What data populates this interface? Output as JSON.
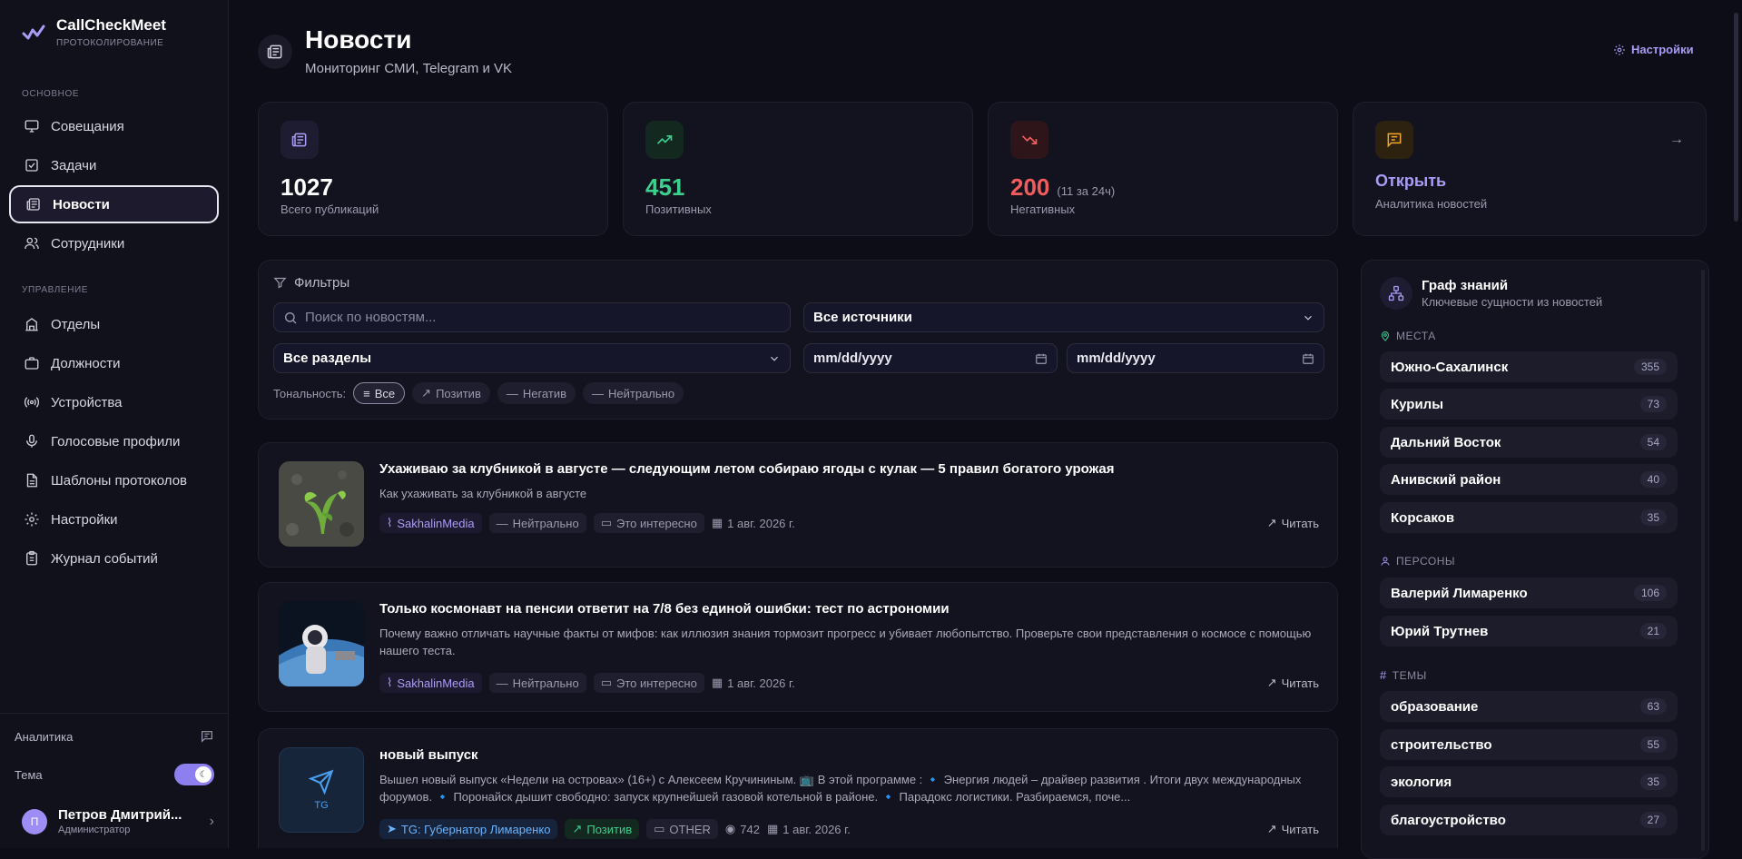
{
  "brand": {
    "title": "CallCheckMeet",
    "subtitle": "ПРОТОКОЛИРОВАНИЕ"
  },
  "sidebar": {
    "section_main": "ОСНОВНОЕ",
    "section_admin": "УПРАВЛЕНИЕ",
    "main_items": [
      {
        "label": "Совещания",
        "icon": "monitor-icon"
      },
      {
        "label": "Задачи",
        "icon": "checkbox-icon"
      },
      {
        "label": "Новости",
        "icon": "newspaper-icon",
        "active": true
      },
      {
        "label": "Сотрудники",
        "icon": "users-icon"
      }
    ],
    "admin_items": [
      {
        "label": "Отделы",
        "icon": "building-icon"
      },
      {
        "label": "Должности",
        "icon": "briefcase-icon"
      },
      {
        "label": "Устройства",
        "icon": "radio-icon"
      },
      {
        "label": "Голосовые профили",
        "icon": "mic-icon"
      },
      {
        "label": "Шаблоны протоколов",
        "icon": "file-icon"
      },
      {
        "label": "Настройки",
        "icon": "gear-icon"
      },
      {
        "label": "Журнал событий",
        "icon": "clipboard-icon"
      }
    ],
    "analytics_label": "Аналитика",
    "theme_label": "Тема",
    "user": {
      "initial": "П",
      "name": "Петров Дмитрий...",
      "role": "Администратор"
    }
  },
  "header": {
    "title": "Новости",
    "subtitle": "Мониторинг СМИ, Telegram и VK",
    "settings_label": "Настройки"
  },
  "stats": [
    {
      "value": "1027",
      "label": "Всего публикаций",
      "color": "#ffffff"
    },
    {
      "value": "451",
      "label": "Позитивных",
      "color": "#3ccf8e"
    },
    {
      "value": "200",
      "extra": "(11 за 24ч)",
      "label": "Негативных",
      "color": "#f25c5c"
    },
    {
      "value": "Открыть",
      "label": "Аналитика новостей",
      "color": "#a99cf5"
    }
  ],
  "filters": {
    "title": "Фильтры",
    "search_placeholder": "Поиск по новостям...",
    "sources": "Все источники",
    "sections": "Все разделы",
    "date_from": "mm/dd/yyyy",
    "date_to": "mm/dd/yyyy",
    "tone_label": "Тональность:",
    "tones": [
      "Все",
      "Позитив",
      "Негатив",
      "Нейтрально"
    ]
  },
  "news": [
    {
      "title": "Ухаживаю за клубникой в августе — следующим летом собираю ягоды с кулак — 5 правил богатого урожая",
      "desc": "Как ухаживать за клубникой в августе",
      "source": "SakhalinMedia",
      "tone": "Нейтрально",
      "section": "Это интересно",
      "date": "1 авг. 2026 г.",
      "read": "Читать"
    },
    {
      "title": "Только космонавт на пенсии ответит на 7/8 без единой ошибки: тест по астрономии",
      "desc": "Почему важно отличать научные факты от мифов: как иллюзия знания тормозит прогресс и убивает любопытство. Проверьте свои представления о космосе с помощью нашего теста.",
      "source": "SakhalinMedia",
      "tone": "Нейтрально",
      "section": "Это интересно",
      "date": "1 авг. 2026 г.",
      "read": "Читать"
    },
    {
      "title": "новый выпуск",
      "desc": "Вышел новый выпуск «Недели на островах» (16+) с Алексеем Кручининым. 📺 В этой программе : 🔹 Энергия людей – драйвер развития . Итоги двух международных форумов. 🔹 Поронайск дышит свободно: запуск крупнейшей газовой котельной в районе. 🔹 Парадокс логистики. Разбираемся, поче...",
      "thumb_label": "TG",
      "source": "TG: Губернатор Лимаренко",
      "tone": "Позитив",
      "section": "OTHER",
      "views": "742",
      "date": "1 авг. 2026 г.",
      "read": "Читать"
    }
  ],
  "graph": {
    "title": "Граф знаний",
    "subtitle": "Ключевые сущности из новостей",
    "places_label": "МЕСТА",
    "places": [
      {
        "name": "Южно-Сахалинск",
        "count": "355"
      },
      {
        "name": "Курилы",
        "count": "73"
      },
      {
        "name": "Дальний Восток",
        "count": "54"
      },
      {
        "name": "Анивский район",
        "count": "40"
      },
      {
        "name": "Корсаков",
        "count": "35"
      }
    ],
    "persons_label": "ПЕРСОНЫ",
    "persons": [
      {
        "name": "Валерий Лимаренко",
        "count": "106"
      },
      {
        "name": "Юрий Трутнев",
        "count": "21"
      }
    ],
    "topics_label": "ТЕМЫ",
    "topics": [
      {
        "name": "образование",
        "count": "63"
      },
      {
        "name": "строительство",
        "count": "55"
      },
      {
        "name": "экология",
        "count": "35"
      },
      {
        "name": "благоустройство",
        "count": "27"
      }
    ]
  },
  "colors": {
    "accent": "#a99cf5",
    "positive": "#3ccf8e",
    "negative": "#f25c5c",
    "warning": "#f5a623",
    "background": "#0d0d17",
    "card": "#13131f"
  }
}
